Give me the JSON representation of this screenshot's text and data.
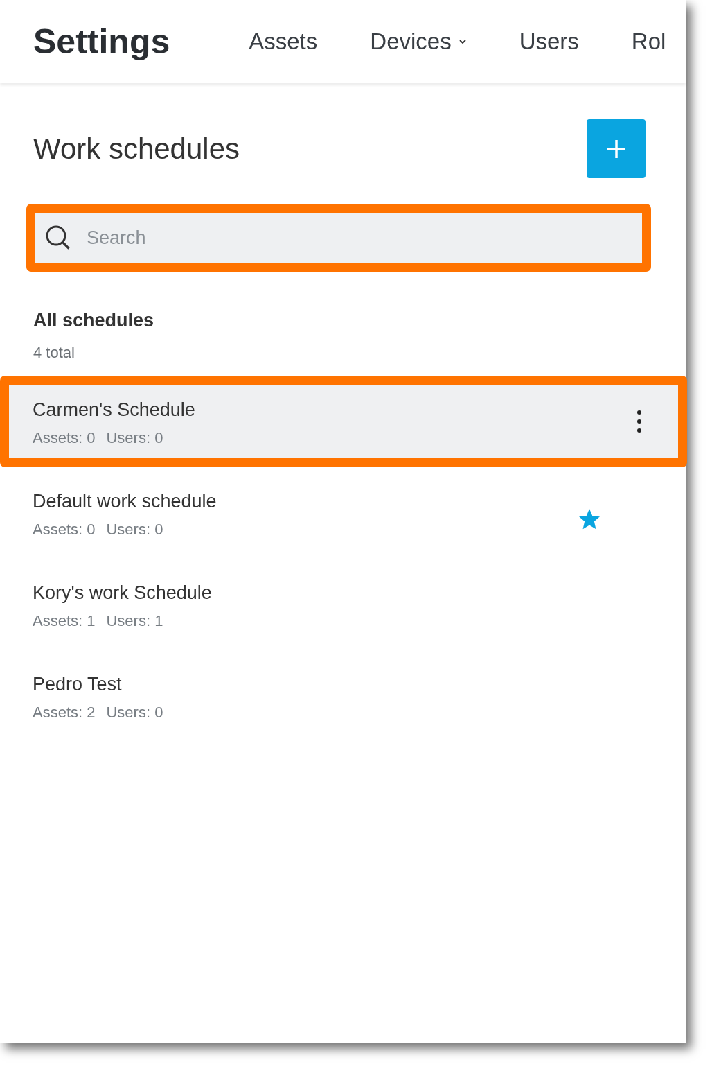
{
  "header": {
    "title": "Settings",
    "nav": [
      {
        "label": "Assets",
        "dropdown": false
      },
      {
        "label": "Devices",
        "dropdown": true
      },
      {
        "label": "Users",
        "dropdown": false
      },
      {
        "label": "Rol",
        "dropdown": false
      }
    ]
  },
  "page_title": "Work schedules",
  "search": {
    "placeholder": "Search",
    "highlighted": true
  },
  "list": {
    "title": "All schedules",
    "count": "4 total"
  },
  "schedules": [
    {
      "name": "Carmen's Schedule",
      "assets": "Assets: 0",
      "users": "Users: 0",
      "hovered": true,
      "highlighted": true,
      "default": false
    },
    {
      "name": "Default work schedule",
      "assets": "Assets: 0",
      "users": "Users: 0",
      "hovered": false,
      "highlighted": false,
      "default": true
    },
    {
      "name": "Kory's work Schedule",
      "assets": "Assets: 1",
      "users": "Users: 1",
      "hovered": false,
      "highlighted": false,
      "default": false
    },
    {
      "name": "Pedro Test",
      "assets": "Assets: 2",
      "users": "Users: 0",
      "hovered": false,
      "highlighted": false,
      "default": false
    }
  ]
}
